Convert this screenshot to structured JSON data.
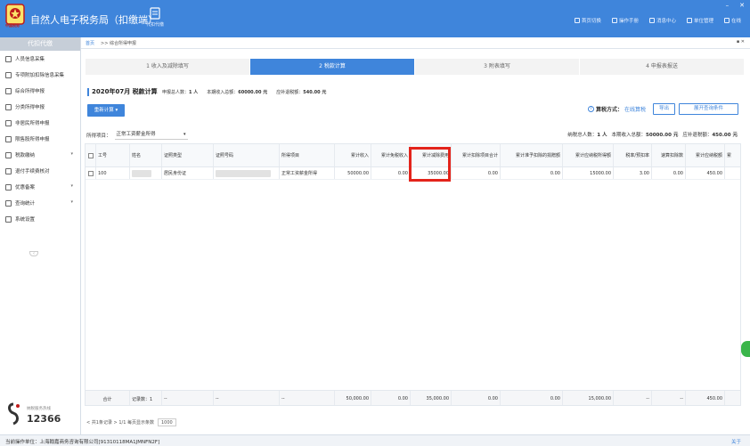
{
  "app": {
    "title": "自然人电子税务局（扣缴端）",
    "logo_text": "中国税务"
  },
  "toolbar": {
    "agent_label": "代扣代缴"
  },
  "top_nav": [
    {
      "label": "首页切换",
      "icon": "home-icon"
    },
    {
      "label": "操作手册",
      "icon": "book-icon"
    },
    {
      "label": "消息中心",
      "icon": "bell-icon"
    },
    {
      "label": "单位管理",
      "icon": "building-icon"
    },
    {
      "label": "在线",
      "icon": "online-icon"
    }
  ],
  "sidebar": {
    "header": "代扣代缴",
    "items": [
      {
        "label": "人员信息采集",
        "icon": "person-icon",
        "has_arrow": false
      },
      {
        "label": "专项附加扣除信息采集",
        "icon": "list-icon",
        "has_arrow": false
      },
      {
        "label": "综合所得申报",
        "icon": "document-icon",
        "has_arrow": false
      },
      {
        "label": "分类所得申报",
        "icon": "document-icon",
        "has_arrow": false
      },
      {
        "label": "非居民所得申报",
        "icon": "globe-icon",
        "has_arrow": false
      },
      {
        "label": "限售股所得申报",
        "icon": "chart-icon",
        "has_arrow": false
      },
      {
        "label": "税款缴纳",
        "icon": "yen-icon",
        "has_arrow": true
      },
      {
        "label": "退付手续费核对",
        "icon": "calculator-icon",
        "has_arrow": false
      },
      {
        "label": "优惠备案",
        "icon": "gift-icon",
        "has_arrow": true
      },
      {
        "label": "查询统计",
        "icon": "search-icon",
        "has_arrow": true
      },
      {
        "label": "系统设置",
        "icon": "gear-icon",
        "has_arrow": false
      }
    ],
    "brand_small": "纳税服务热线",
    "brand_number": "12366"
  },
  "breadcrumb": {
    "home": "首页",
    "current": ">> 综合所得申报"
  },
  "steps": [
    {
      "label": "1 收入及减除填写",
      "active": false
    },
    {
      "label": "2 税款计算",
      "active": true
    },
    {
      "label": "3 附表填写",
      "active": false
    },
    {
      "label": "4 申报表报送",
      "active": false
    }
  ],
  "period": {
    "title": "2020年07月 税款计算",
    "declare_count_label": "申报总人数：",
    "declare_count": "1 人",
    "income_label": "本期收入总额：",
    "income": "60000.00 元",
    "refund_label": "应补退税额：",
    "refund": "540.00 元"
  },
  "actions": {
    "recalc": "重新计算 ▾",
    "method_label": "算税方式：",
    "method_value": "在线算税",
    "export": "导出",
    "expand": "展开查询条件"
  },
  "filter": {
    "label": "所得项目：",
    "value": "正常工资薪金所得"
  },
  "summary": {
    "count_label": "纳税总人数：",
    "count": "1 人",
    "income_label": "本期收入总额：",
    "income": "50000.00 元",
    "refund_label": "应补退税额：",
    "refund": "450.00 元"
  },
  "table": {
    "headers": [
      "",
      "工号",
      "姓名",
      "证照类型",
      "证照号码",
      "所得项目",
      "累计收入",
      "累计免税收入",
      "累计减除费用",
      "累计扣除项目合计",
      "累计准予扣除的捐赠额",
      "累计应纳税所得额",
      "税率/预扣率",
      "速算扣除数",
      "累计应纳税额",
      "累"
    ],
    "rows": [
      [
        "",
        "100",
        "",
        "居民身份证",
        "",
        "正常工资薪金所得",
        "50000.00",
        "0.00",
        "35000.00",
        "0.00",
        "0.00",
        "15000.00",
        "3.00",
        "0.00",
        "450.00",
        ""
      ]
    ],
    "footer": [
      "合计",
      "记录数：1",
      "--",
      "--",
      "--",
      "",
      "50,000.00",
      "0.00",
      "35,000.00",
      "0.00",
      "0.00",
      "15,000.00",
      "--",
      "--",
      "450.00",
      ""
    ]
  },
  "pager": {
    "summary": "< 共1条记录 > 1/1 每页显示条数",
    "page_size": "1000"
  },
  "status": {
    "unit": "当前操作单位：上海翰嘉商务咨询有限公司[91310118MA1JMNFN2F]",
    "about": "关于"
  },
  "colors": {
    "brand_blue": "#3f85db",
    "highlight_red": "#e3241b"
  }
}
